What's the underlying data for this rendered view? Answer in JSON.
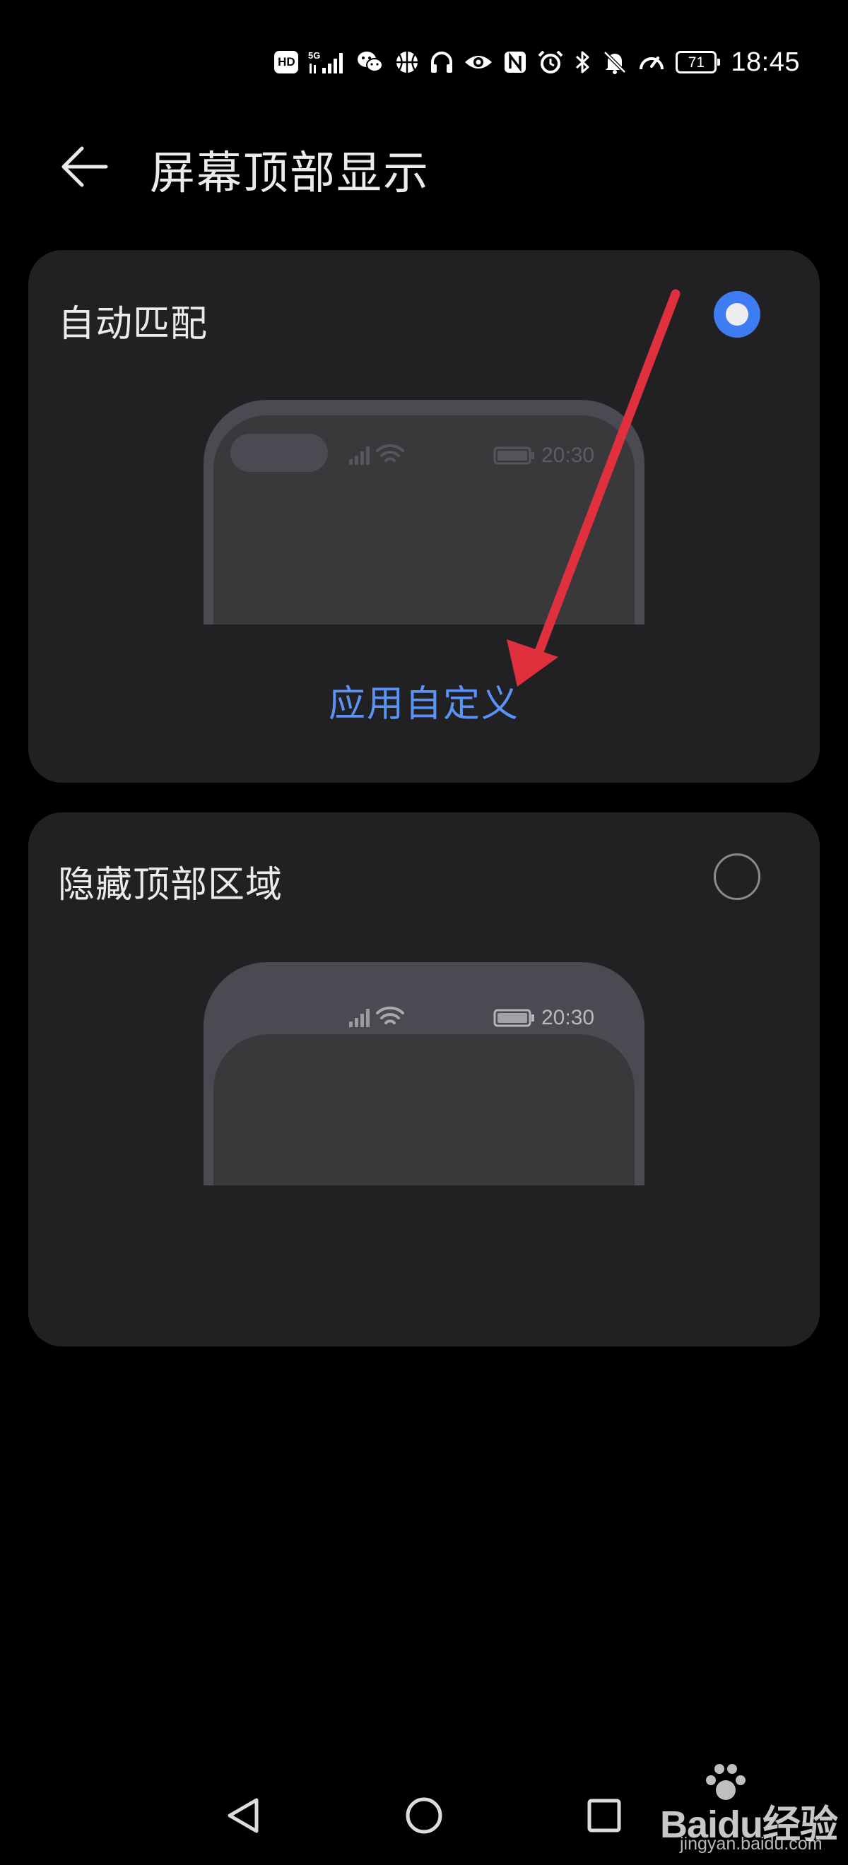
{
  "status_bar": {
    "hd_badge": "HD",
    "network": "5G",
    "battery_level": "71",
    "time": "18:45",
    "icons": [
      "hd-icon",
      "5g-signal-icon",
      "wechat-icon",
      "basketball-icon",
      "headphones-icon",
      "eye-icon",
      "nfc-icon",
      "alarm-icon",
      "bluetooth-icon",
      "mute-bell-icon",
      "speedometer-icon",
      "battery-icon"
    ]
  },
  "header": {
    "title": "屏幕顶部显示",
    "back_icon": "arrow-left-icon"
  },
  "options": [
    {
      "label": "自动匹配",
      "selected": true,
      "preview_time": "20:30",
      "custom_link": "应用自定义"
    },
    {
      "label": "隐藏顶部区域",
      "selected": false,
      "preview_time": "20:30"
    }
  ],
  "nav_bar": {
    "icons": [
      "back-triangle-icon",
      "home-circle-icon",
      "recents-square-icon"
    ]
  },
  "watermark": {
    "brand": "Baidu经验",
    "url": "jingyan.baidu.com"
  },
  "colors": {
    "background": "#000000",
    "card": "#212124",
    "accent": "#3d7cf2",
    "link": "#5a92f5",
    "annotation": "#e0303e"
  }
}
